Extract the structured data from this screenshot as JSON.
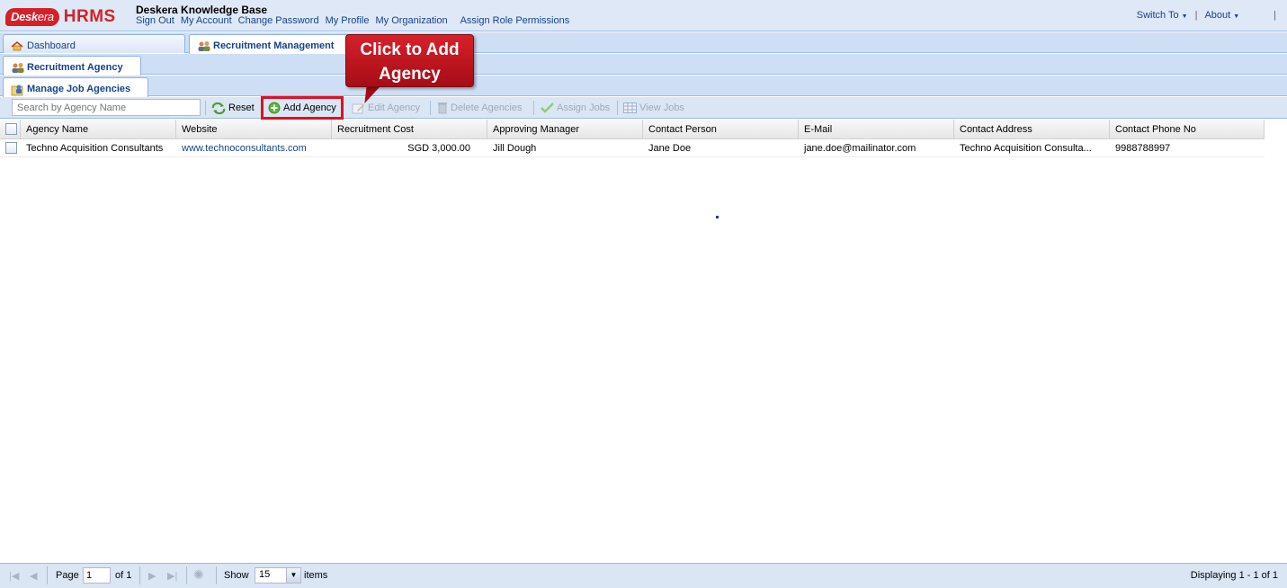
{
  "app": {
    "logo_desk": "Desk",
    "logo_era": "era",
    "logo_hrms": "HRMS",
    "company": "Deskera Knowledge Base"
  },
  "toplinks": [
    "Sign Out",
    "My Account",
    "Change Password",
    "My Profile",
    "My Organization",
    "Assign Role Permissions"
  ],
  "topright": {
    "switch_to": "Switch To",
    "about": "About"
  },
  "tabs": {
    "dashboard": "Dashboard",
    "recruitment_management": "Recruitment Management",
    "recruitment_agency": "Recruitment Agency",
    "manage_job_agencies": "Manage Job Agencies"
  },
  "toolbar": {
    "search_placeholder": "Search by Agency Name",
    "reset": "Reset",
    "add_agency": "Add Agency",
    "edit_agency": "Edit Agency",
    "delete_agencies": "Delete Agencies",
    "assign_jobs": "Assign Jobs",
    "view_jobs": "View Jobs"
  },
  "grid": {
    "columns": [
      "Agency Name",
      "Website",
      "Recruitment Cost",
      "Approving Manager",
      "Contact Person",
      "E-Mail",
      "Contact Address",
      "Contact Phone No"
    ],
    "rows": [
      {
        "agency_name": "Techno Acquisition Consultants",
        "website": "www.technoconsultants.com",
        "recruitment_cost": "SGD 3,000.00",
        "approving_manager": "Jill Dough",
        "contact_person": "Jane Doe",
        "email": "jane.doe@mailinator.com",
        "contact_address": "Techno Acquisition Consulta...",
        "contact_phone": "9988788997"
      }
    ]
  },
  "callout": {
    "line1": "Click to Add",
    "line2": "Agency"
  },
  "pager": {
    "page_label": "Page",
    "page_value": "1",
    "of_label": "of 1",
    "show_label": "Show",
    "show_value": "15",
    "items_label": "items",
    "displaying": "Displaying 1 - 1 of 1"
  },
  "colors": {
    "accent": "#15428b",
    "highlight": "#e01020",
    "callout": "#c0141c",
    "panel": "#dae6f4"
  }
}
